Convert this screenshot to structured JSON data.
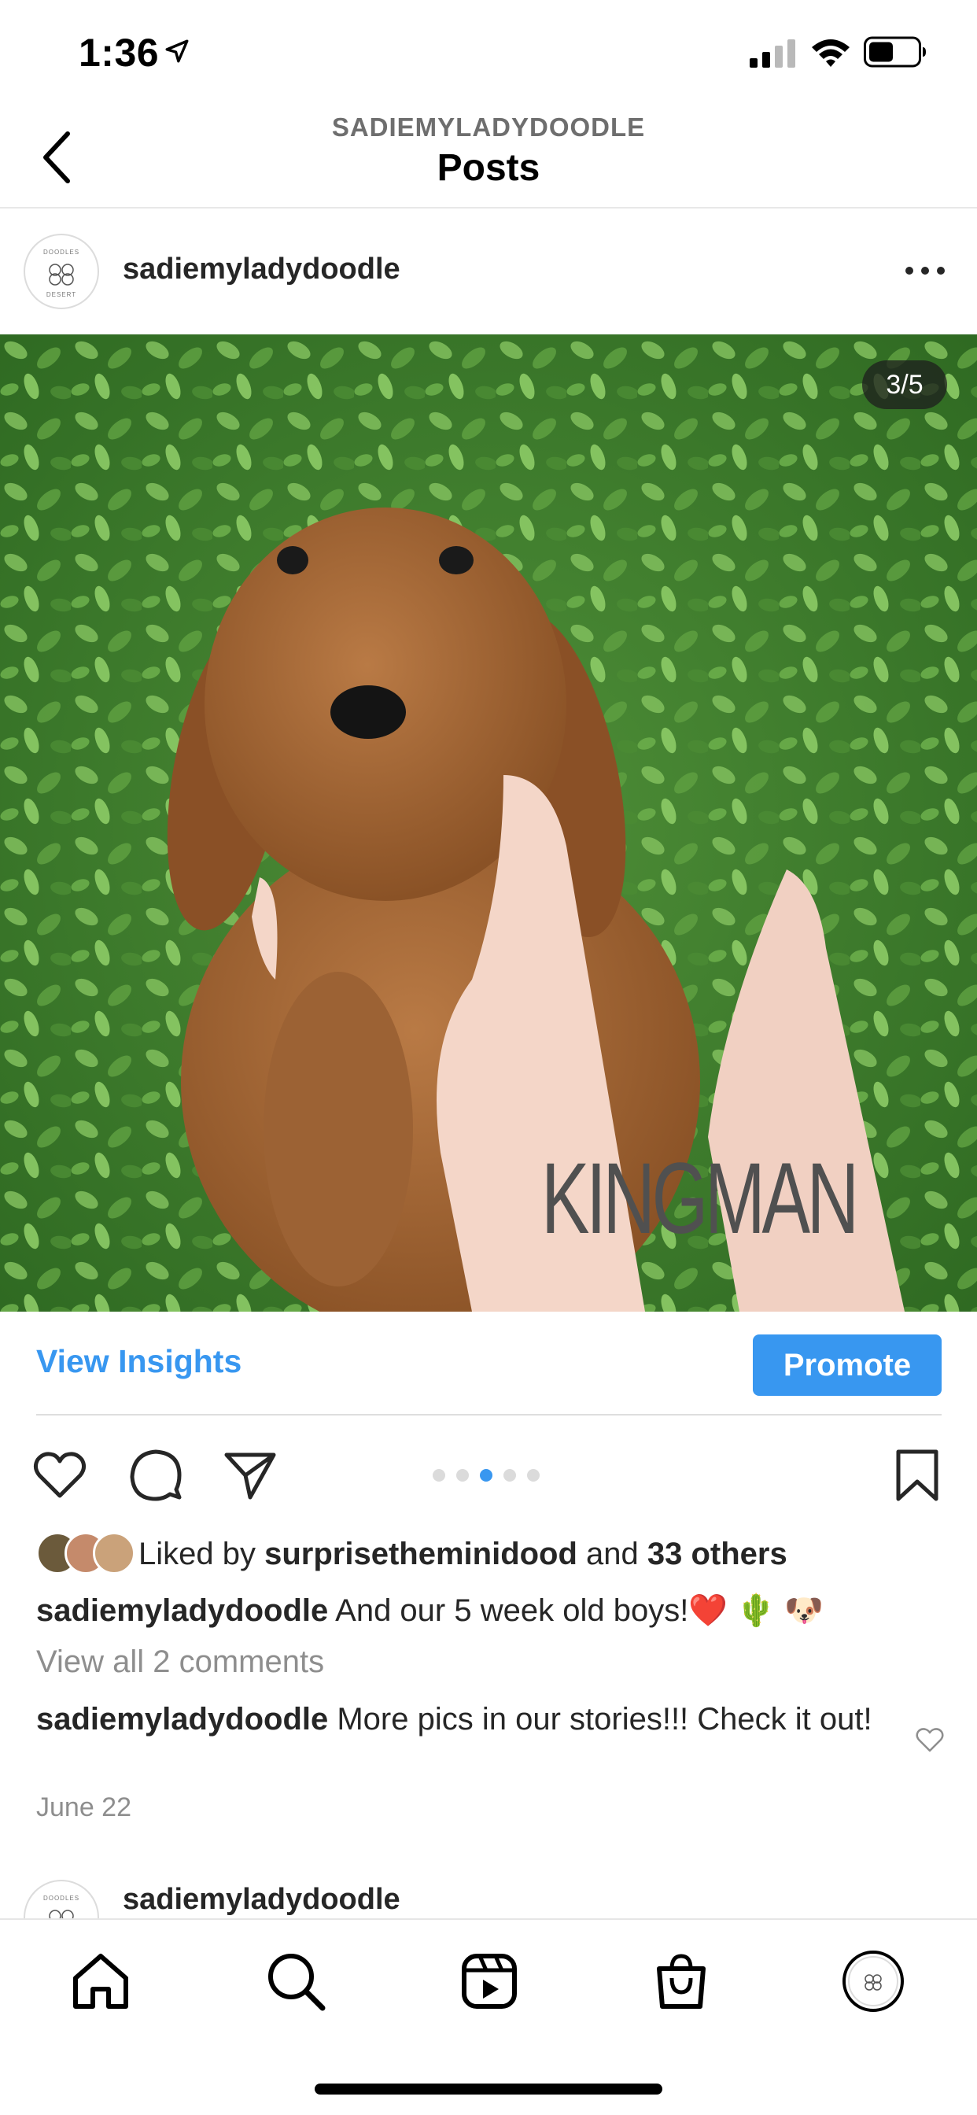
{
  "status_bar": {
    "time": "1:36"
  },
  "header": {
    "subtitle": "SADIEMYLADYDOODLE",
    "title": "Posts"
  },
  "post": {
    "username": "sadiemyladydoodle",
    "avatar_text_top": "DOODLES",
    "avatar_text_bottom": "DESERT",
    "image_counter": "3/5",
    "image_overlay_text": "KINGMAN",
    "carousel": {
      "total": 5,
      "active_index": 2
    },
    "insights_label": "View Insights",
    "promote_label": "Promote",
    "likes": {
      "prefix": "Liked by ",
      "first_user": "surprisetheminidood",
      "middle": " and ",
      "others": "33 others"
    },
    "caption": {
      "username": "sadiemyladydoodle",
      "text": " And our 5 week old boys!",
      "emojis": "❤️ 🌵 🐶"
    },
    "view_comments": "View all 2 comments",
    "comment": {
      "username": "sadiemyladydoodle",
      "text": " More pics in our stories!!! Check it out!"
    },
    "date": "June 22"
  },
  "next_post": {
    "username": "sadiemyladydoodle"
  },
  "tab_bar": {
    "items": [
      "home-icon",
      "search-icon",
      "reels-icon",
      "shop-icon",
      "profile-avatar"
    ]
  },
  "colors": {
    "accent": "#3897f0",
    "text": "#262626",
    "secondary_text": "#8e8e8e"
  }
}
